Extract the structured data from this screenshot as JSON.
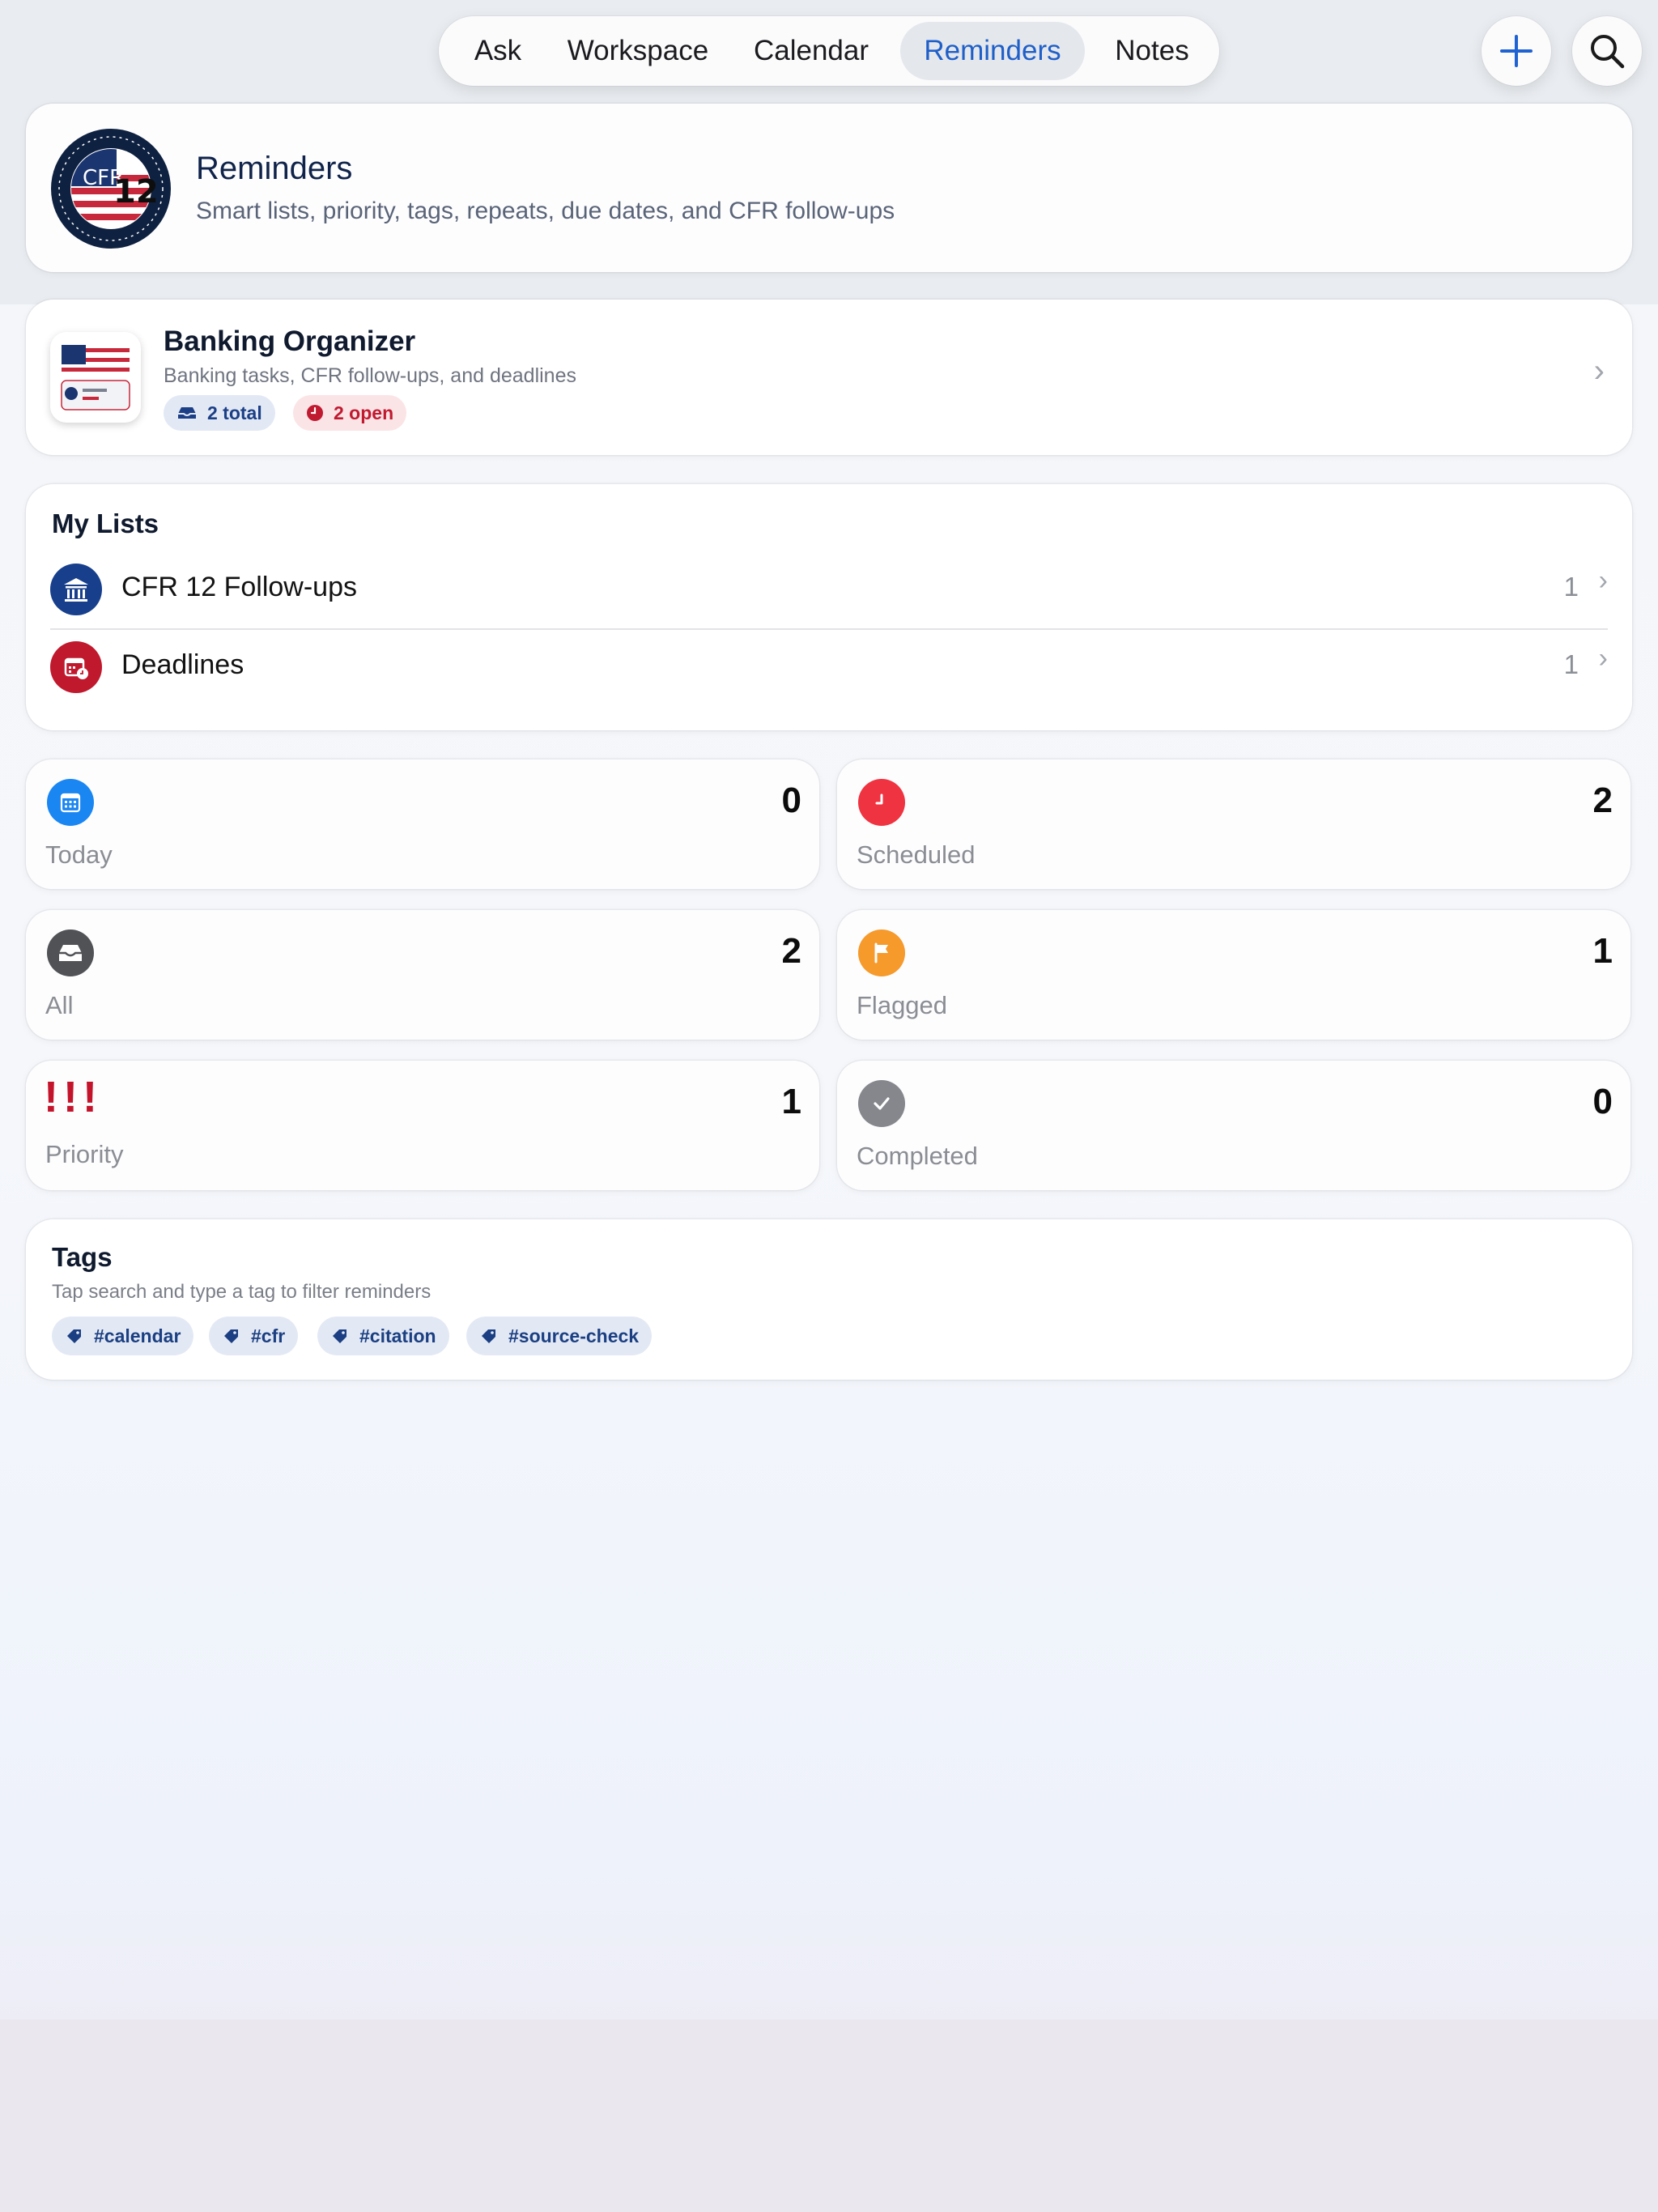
{
  "nav": {
    "tabs": [
      {
        "label": "Ask"
      },
      {
        "label": "Workspace"
      },
      {
        "label": "Calendar"
      },
      {
        "label": "Reminders",
        "active": true
      },
      {
        "label": "Notes"
      }
    ],
    "add_icon": "plus-icon",
    "search_icon": "magnifier-icon"
  },
  "header": {
    "title": "Reminders",
    "subtitle": "Smart lists, priority, tags, repeats, due dates, and CFR follow-ups",
    "seal_text": "CFR",
    "seal_number": "12"
  },
  "organizer": {
    "title": "Banking Organizer",
    "subtitle": "Banking tasks, CFR follow-ups, and deadlines",
    "total_badge": "2 total",
    "open_badge": "2 open"
  },
  "my_lists": {
    "title": "My Lists",
    "items": [
      {
        "label": "CFR 12 Follow-ups",
        "count": "1",
        "icon": "bank-icon",
        "color": "#173f8c"
      },
      {
        "label": "Deadlines",
        "count": "1",
        "icon": "calendar-clock-icon",
        "color": "#c0182d"
      }
    ]
  },
  "smart_lists": [
    {
      "label": "Today",
      "count": "0",
      "icon": "calendar-icon",
      "color": "#1a86f2"
    },
    {
      "label": "Scheduled",
      "count": "2",
      "icon": "clock-icon",
      "color": "#ef3340"
    },
    {
      "label": "All",
      "count": "2",
      "icon": "tray-icon",
      "color": "#505256"
    },
    {
      "label": "Flagged",
      "count": "1",
      "icon": "flag-icon",
      "color": "#f59a2b"
    },
    {
      "label": "Priority",
      "count": "1",
      "icon": "exclamation-icon",
      "color": "#c4142b",
      "glyph": "!!!"
    },
    {
      "label": "Completed",
      "count": "0",
      "icon": "checkmark-icon",
      "color": "#85878c"
    }
  ],
  "tags": {
    "title": "Tags",
    "subtitle": "Tap search and type a tag to filter reminders",
    "items": [
      "#calendar",
      "#cfr",
      "#citation",
      "#source-check"
    ]
  }
}
